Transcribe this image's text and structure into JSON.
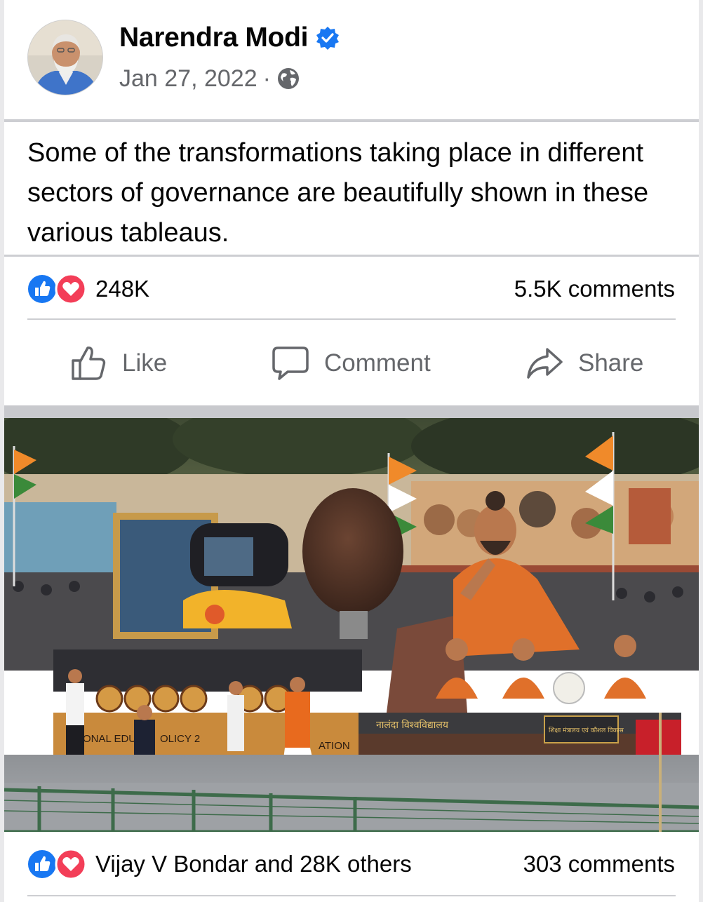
{
  "post": {
    "author": "Narendra Modi",
    "date": "Jan 27, 2022",
    "separator": "·",
    "text": "Some of the transformations taking place in different sectors of governance are beautifully shown in these various tableaus.",
    "reaction_count": "248K",
    "comment_count": "5.5K comments"
  },
  "actions": {
    "like": "Like",
    "comment": "Comment",
    "share": "Share"
  },
  "photo": {
    "float_signs": {
      "policy_left": "ONAL EDU",
      "policy_mid": "OLICY 2",
      "policy_right": "ATION",
      "hindi_banner": "नालंदा विश्वविद्यालय",
      "ministry_plaque": "शिक्षा मंत्रालय एवं कौशल विकास"
    }
  },
  "photo_stats": {
    "reactors": "Vijay V Bondar and 28K others",
    "comment_count": "303 comments"
  },
  "colors": {
    "like_blue": "#1877f2",
    "love_red": "#f33e58",
    "meta_gray": "#65676b",
    "divider": "#cdced2"
  },
  "icons": {
    "verified": "verified-badge-icon",
    "privacy": "globe-icon",
    "like": "thumbs-up-icon",
    "comment": "speech-bubble-icon",
    "share": "share-arrow-icon"
  }
}
